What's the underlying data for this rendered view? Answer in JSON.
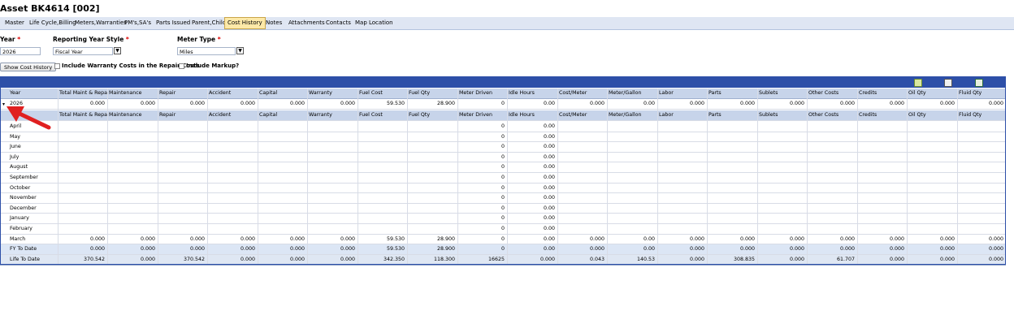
{
  "window": {
    "title": "Asset BK4614 [002]"
  },
  "tabs": [
    {
      "label": "Master",
      "active": false
    },
    {
      "label": "Life Cycle,Billing",
      "active": false
    },
    {
      "label": "Meters,Warranties",
      "active": false
    },
    {
      "label": "PM's,SA's",
      "active": false
    },
    {
      "label": "Parts Issued",
      "active": false
    },
    {
      "label": "Parent,Child",
      "active": false
    },
    {
      "label": "Cost History",
      "active": true
    },
    {
      "label": "Notes",
      "active": false
    },
    {
      "label": "Attachments",
      "active": false
    },
    {
      "label": "Contacts",
      "active": false
    },
    {
      "label": "Map Location",
      "active": false
    }
  ],
  "filters": {
    "year_label": "Year",
    "year_value": "2026",
    "reporting_label": "Reporting Year Style",
    "reporting_value": "Fiscal Year",
    "meter_label": "Meter Type",
    "meter_value": "Miles",
    "required_mark": "*",
    "show_button": "Show Cost History",
    "warranty_checkbox": "Include Warranty Costs in the Repair Costs",
    "markup_checkbox": "Include Markup?"
  },
  "columns": [
    "Year",
    "Total Maint & Repair",
    "Maintenance",
    "Repair",
    "Accident",
    "Capital",
    "Warranty",
    "Fuel Cost",
    "Fuel Qty",
    "Meter Driven",
    "Idle Hours",
    "Cost/Meter",
    "Meter/Gallon",
    "Labor",
    "Parts",
    "Sublets",
    "Other Costs",
    "Credits",
    "Oil Qty",
    "Fluid Qty"
  ],
  "year_row": [
    "2026",
    "0.000",
    "0.000",
    "0.000",
    "0.000",
    "0.000",
    "0.000",
    "59.530",
    "28.900",
    "0",
    "0.00",
    "0.000",
    "0.00",
    "0.000",
    "0.000",
    "0.000",
    "0.000",
    "0.000",
    "0.000",
    "0.000"
  ],
  "sub_columns": [
    "",
    "Total Maint & Repair",
    "Maintenance",
    "Repair",
    "Accident",
    "Capital",
    "Warranty",
    "Fuel Cost",
    "Fuel Qty",
    "Meter Driven",
    "Idle Hours",
    "Cost/Meter",
    "Meter/Gallon",
    "Labor",
    "Parts",
    "Sublets",
    "Other Costs",
    "Credits",
    "Oil Qty",
    "Fluid Qty"
  ],
  "month_rows": [
    [
      "April",
      "",
      "",
      "",
      "",
      "",
      "",
      "",
      "",
      "0",
      "0.00",
      "",
      "",
      "",
      "",
      "",
      "",
      "",
      "",
      ""
    ],
    [
      "May",
      "",
      "",
      "",
      "",
      "",
      "",
      "",
      "",
      "0",
      "0.00",
      "",
      "",
      "",
      "",
      "",
      "",
      "",
      "",
      ""
    ],
    [
      "June",
      "",
      "",
      "",
      "",
      "",
      "",
      "",
      "",
      "0",
      "0.00",
      "",
      "",
      "",
      "",
      "",
      "",
      "",
      "",
      ""
    ],
    [
      "July",
      "",
      "",
      "",
      "",
      "",
      "",
      "",
      "",
      "0",
      "0.00",
      "",
      "",
      "",
      "",
      "",
      "",
      "",
      "",
      ""
    ],
    [
      "August",
      "",
      "",
      "",
      "",
      "",
      "",
      "",
      "",
      "0",
      "0.00",
      "",
      "",
      "",
      "",
      "",
      "",
      "",
      "",
      ""
    ],
    [
      "September",
      "",
      "",
      "",
      "",
      "",
      "",
      "",
      "",
      "0",
      "0.00",
      "",
      "",
      "",
      "",
      "",
      "",
      "",
      "",
      ""
    ],
    [
      "October",
      "",
      "",
      "",
      "",
      "",
      "",
      "",
      "",
      "0",
      "0.00",
      "",
      "",
      "",
      "",
      "",
      "",
      "",
      "",
      ""
    ],
    [
      "November",
      "",
      "",
      "",
      "",
      "",
      "",
      "",
      "",
      "0",
      "0.00",
      "",
      "",
      "",
      "",
      "",
      "",
      "",
      "",
      ""
    ],
    [
      "December",
      "",
      "",
      "",
      "",
      "",
      "",
      "",
      "",
      "0",
      "0.00",
      "",
      "",
      "",
      "",
      "",
      "",
      "",
      "",
      ""
    ],
    [
      "January",
      "",
      "",
      "",
      "",
      "",
      "",
      "",
      "",
      "0",
      "0.00",
      "",
      "",
      "",
      "",
      "",
      "",
      "",
      "",
      ""
    ],
    [
      "February",
      "",
      "",
      "",
      "",
      "",
      "",
      "",
      "",
      "0",
      "0.00",
      "",
      "",
      "",
      "",
      "",
      "",
      "",
      "",
      ""
    ],
    [
      "March",
      "0.000",
      "0.000",
      "0.000",
      "0.000",
      "0.000",
      "0.000",
      "59.530",
      "28.900",
      "0",
      "0.00",
      "0.000",
      "0.00",
      "0.000",
      "0.000",
      "0.000",
      "0.000",
      "0.000",
      "0.000",
      "0.000"
    ]
  ],
  "fy_row": [
    "FY To Date",
    "0.000",
    "0.000",
    "0.000",
    "0.000",
    "0.000",
    "0.000",
    "59.530",
    "28.900",
    "0",
    "0.00",
    "0.000",
    "0.00",
    "0.000",
    "0.000",
    "0.000",
    "0.000",
    "0.000",
    "0.000",
    "0.000"
  ],
  "life_row": [
    "Life To Date",
    "370.542",
    "0.000",
    "370.542",
    "0.000",
    "0.000",
    "0.000",
    "342.350",
    "118.300",
    "16625",
    "0.000",
    "0.043",
    "140.53",
    "0.000",
    "308.835",
    "0.000",
    "61.707",
    "0.000",
    "0.000",
    "0.000"
  ],
  "toolbar_icons": [
    "export-excel-icon",
    "print-icon",
    "calendar-icon"
  ],
  "colors": {
    "grid_header": "#2d4fa8",
    "tab_active": "#fde9a8",
    "annotation_arrow": "#e02020"
  }
}
